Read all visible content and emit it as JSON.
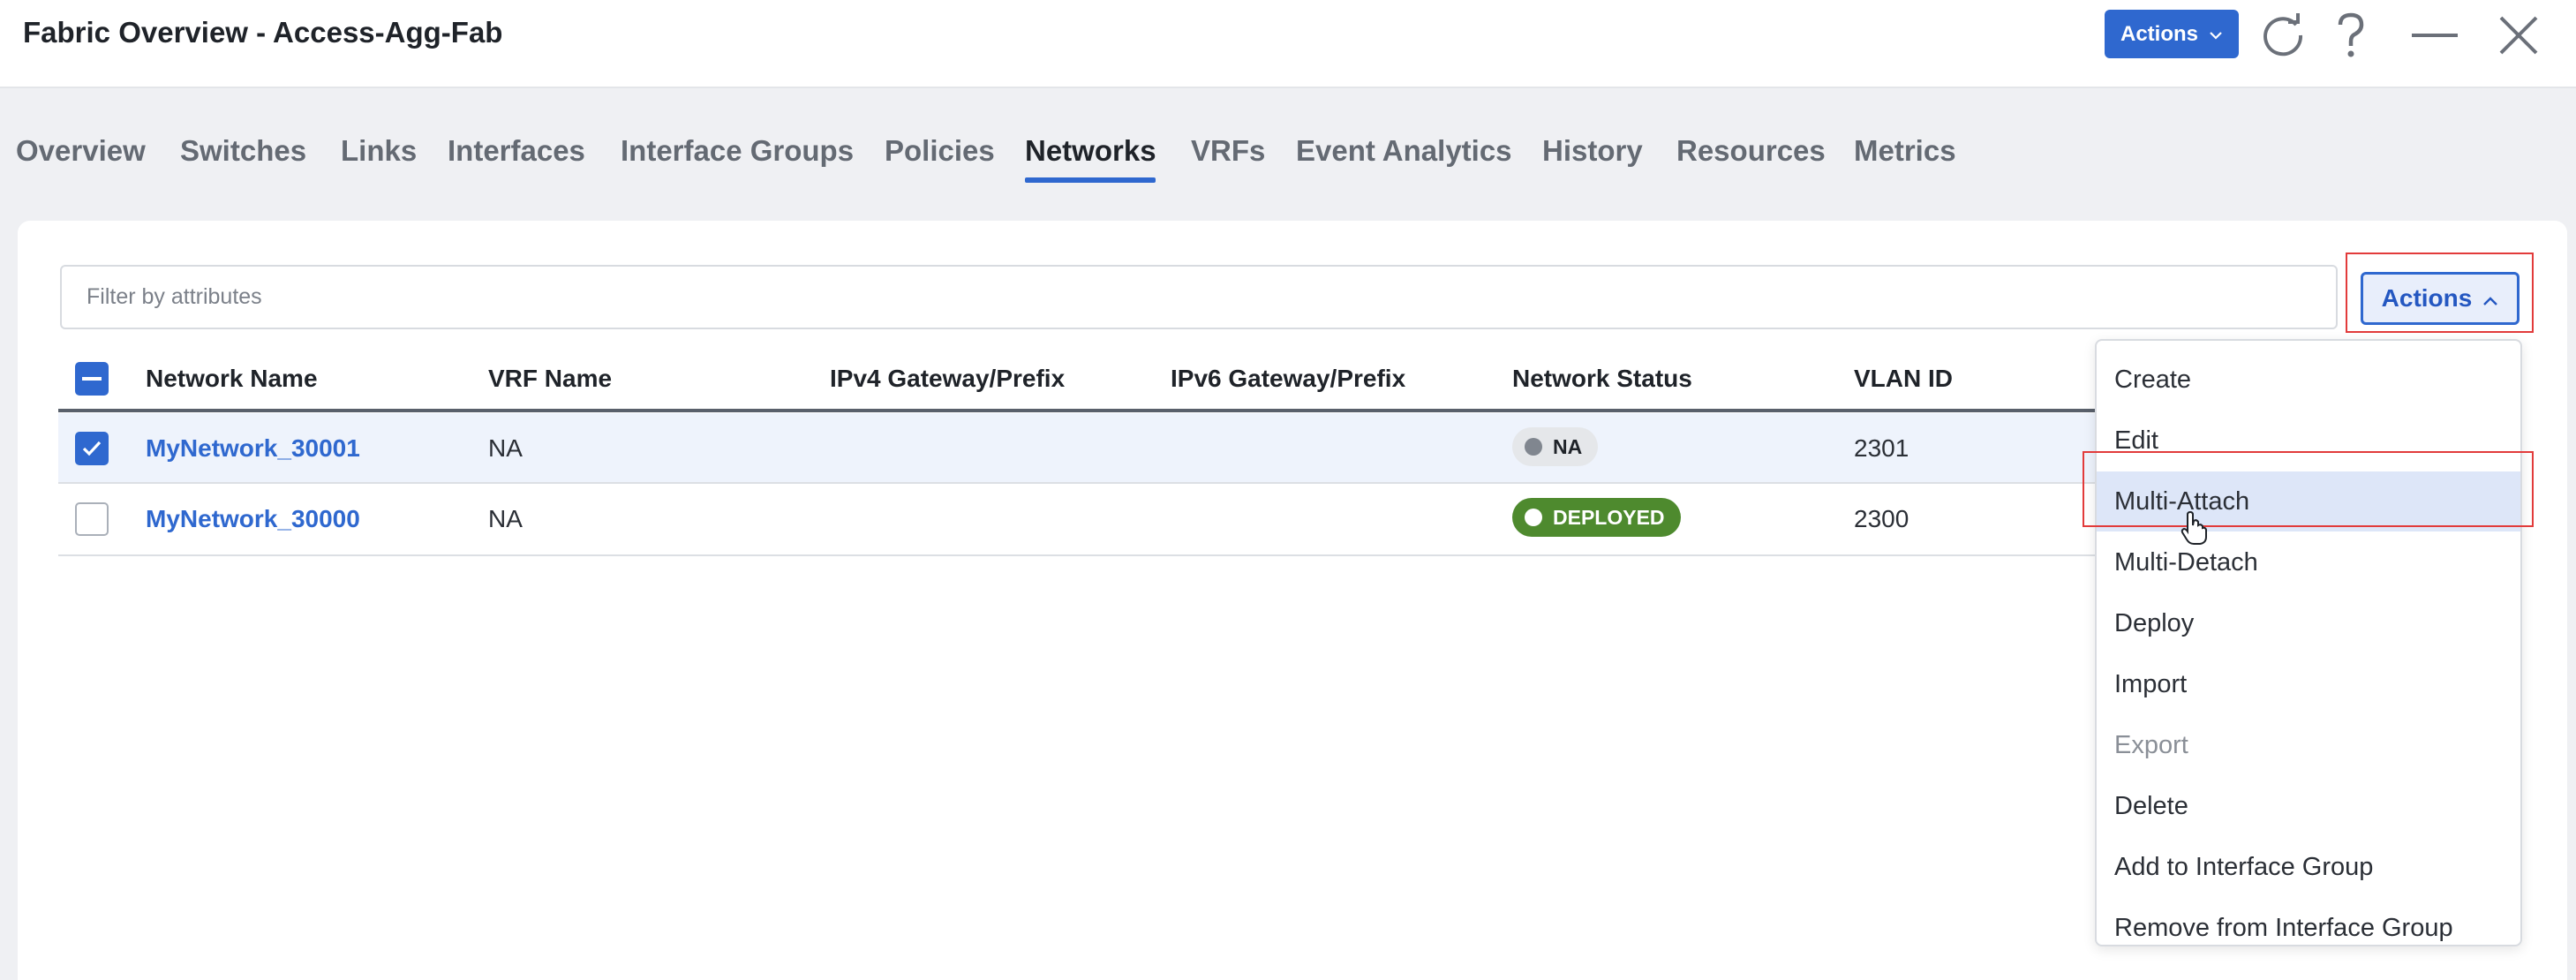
{
  "header": {
    "title": "Fabric Overview - Access-Agg-Fab",
    "actions_label": "Actions",
    "icons": [
      "refresh-icon",
      "help-icon",
      "minimize-icon",
      "close-icon"
    ]
  },
  "tabs": [
    {
      "label": "Overview"
    },
    {
      "label": "Switches"
    },
    {
      "label": "Links"
    },
    {
      "label": "Interfaces"
    },
    {
      "label": "Interface Groups"
    },
    {
      "label": "Policies"
    },
    {
      "label": "Networks",
      "active": true
    },
    {
      "label": "VRFs"
    },
    {
      "label": "Event Analytics"
    },
    {
      "label": "History"
    },
    {
      "label": "Resources"
    },
    {
      "label": "Metrics"
    }
  ],
  "toolbar": {
    "filter_placeholder": "Filter by attributes",
    "actions_label": "Actions"
  },
  "table": {
    "columns": [
      "Network Name",
      "VRF Name",
      "IPv4 Gateway/Prefix",
      "IPv6 Gateway/Prefix",
      "Network Status",
      "VLAN ID"
    ],
    "rows": [
      {
        "network_name": "MyNetwork_30001",
        "vrf_name": "NA",
        "ipv4": "",
        "ipv6": "",
        "status": "NA",
        "vlan_id": "2301",
        "selected": true
      },
      {
        "network_name": "MyNetwork_30000",
        "vrf_name": "NA",
        "ipv4": "",
        "ipv6": "",
        "status": "DEPLOYED",
        "vlan_id": "2300",
        "selected": false
      }
    ]
  },
  "actions_menu": {
    "items": [
      {
        "label": "Create"
      },
      {
        "label": "Edit"
      },
      {
        "label": "Multi-Attach",
        "highlighted": true
      },
      {
        "label": "Multi-Detach"
      },
      {
        "label": "Deploy"
      },
      {
        "label": "Import"
      },
      {
        "label": "Export",
        "disabled": true
      },
      {
        "label": "Delete"
      },
      {
        "label": "Add to Interface Group"
      },
      {
        "label": "Remove from Interface Group"
      }
    ]
  },
  "colors": {
    "accent": "#2f68cf",
    "deployed": "#4e8a2e",
    "na_badge": "#e5e7ea",
    "highlight_border": "#e23b3b"
  }
}
